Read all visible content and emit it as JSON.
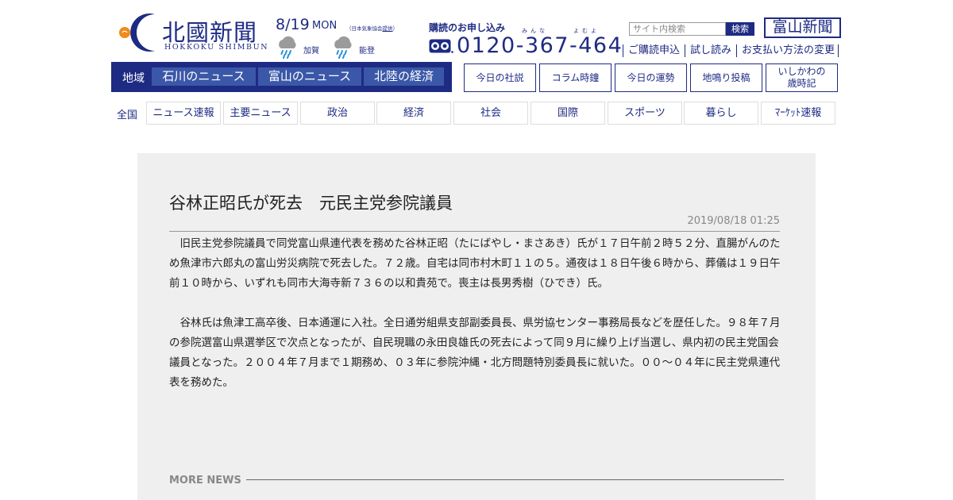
{
  "logo": {
    "name": "北國新聞",
    "sub": "HOKKOKU SHIMBUN"
  },
  "weather": {
    "date": "8/19",
    "dow": "MON",
    "note_pre": "（日本気象協会",
    "note_link": "提供",
    "note_post": "）",
    "areas": [
      {
        "label": "加賀",
        "icon": "rain-cloud-icon"
      },
      {
        "label": "能登",
        "icon": "rain-cloud-icon"
      }
    ]
  },
  "subscribe": {
    "title": "購読のお申し込み",
    "ruby_1": "みんな",
    "ruby_2": "よむよ",
    "phone": "0120-367-464"
  },
  "search": {
    "placeholder": "サイト内検索",
    "button": "検索"
  },
  "toyama_button": "富山新聞",
  "links": [
    "ご購読申込",
    "試し読み",
    "お支払い方法の変更"
  ],
  "region": {
    "label": "地域",
    "tabs": [
      "石川のニュース",
      "富山のニュース",
      "北陸の経済"
    ]
  },
  "columns": [
    "今日の社説",
    "コラム時鐘",
    "今日の運勢",
    "地鳴り投稿",
    "いしかわの",
    "歳時記"
  ],
  "nav": {
    "all": "全国",
    "items": [
      "ニュース速報",
      "主要ニュース",
      "政治",
      "経済",
      "社会",
      "国際",
      "スポーツ",
      "暮らし",
      "ﾏｰｹｯﾄ速報"
    ]
  },
  "article": {
    "title": "谷林正昭氏が死去　元民主党参院議員",
    "date": "2019/08/18 01:25",
    "paragraphs": [
      "旧民主党参院議員で同党富山県連代表を務めた谷林正昭（たにばやし・まさあき）氏が１７日午前２時５２分、直腸がんのため魚津市六郎丸の富山労災病院で死去した。７２歳。自宅は同市村木町１１の５。通夜は１８日午後６時から、葬儀は１９日午前１０時から、いずれも同市大海寺新７３６の以和貴苑で。喪主は長男秀樹（ひでき）氏。",
      "谷林氏は魚津工高卒後、日本通運に入社。全日通労組県支部副委員長、県労協センター事務局長などを歴任した。９８年７月の参院選富山県選挙区で次点となったが、自民現職の永田良雄氏の死去によって同９月に繰り上げ当選し、県内初の民主党国会議員となった。２００４年７月まで１期務め、０３年に参院沖縄・北方問題特別委員長に就いた。００～０４年に民主党県連代表を務めた。"
    ]
  },
  "more_news": "MORE NEWS",
  "colors": {
    "brand": "#1e2b83",
    "tab": "#3b58a8",
    "accent_orange": "#f08a1c",
    "panel": "#efefef"
  }
}
